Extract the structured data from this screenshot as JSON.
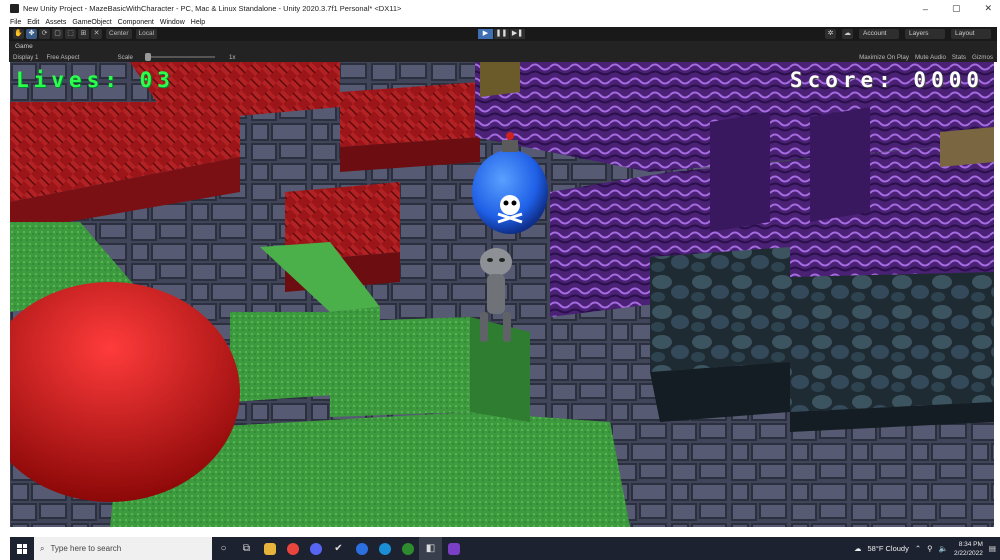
{
  "window": {
    "title": "New Unity Project - MazeBasicWithCharacter - PC, Mac & Linux Standalone - Unity 2020.3.7f1 Personal* <DX11>",
    "minimize": "–",
    "maximize": "▢",
    "close": "✕"
  },
  "menu": [
    "File",
    "Edit",
    "Assets",
    "GameObject",
    "Component",
    "Window",
    "Help"
  ],
  "toolbar": {
    "tools": [
      "✋",
      "✥",
      "⟳",
      "▢",
      "⬚",
      "⊞",
      "✕"
    ],
    "pivot_label": "Center",
    "space_label": "Local",
    "play": "▶",
    "pause": "❚❚",
    "step": "▶❚",
    "account_label": "Account",
    "layers_label": "Layers",
    "layout_label": "Layout"
  },
  "game_tab": {
    "label": "Game"
  },
  "game_controls": {
    "display": "Display 1",
    "aspect": "Free Aspect",
    "scale_label": "Scale",
    "scale_value": "1x",
    "maximize": "Maximize On Play",
    "mute": "Mute Audio",
    "stats": "Stats",
    "gizmos": "Gizmos"
  },
  "hud": {
    "lives": "Lives: 03",
    "score": "Score: 0000"
  },
  "taskbar": {
    "search_placeholder": "Type here to search",
    "weather": "58°F Cloudy",
    "time": "8:34 PM",
    "date": "2/22/2022"
  },
  "colors": {
    "lives_green": "#2cff4b",
    "bomb_blue": "#1f5fe6",
    "red_wall": "#a5181c",
    "purple_wall": "#5a2a86",
    "green_block": "#3d9a3e",
    "floor": "#4b4f63"
  }
}
